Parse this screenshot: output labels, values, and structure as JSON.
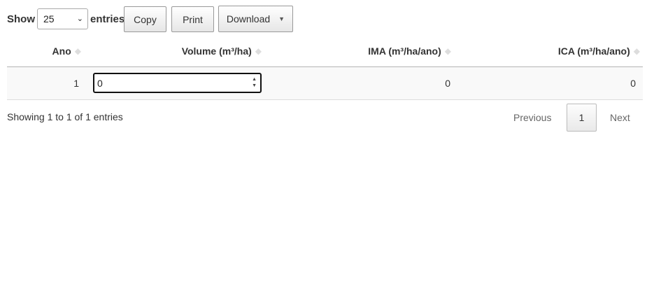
{
  "length_menu": {
    "prefix": "Show",
    "selected": "25",
    "suffix": "entries"
  },
  "buttons": {
    "copy": "Copy",
    "print": "Print",
    "download": "Download"
  },
  "table": {
    "columns": [
      {
        "label": "Ano"
      },
      {
        "label": "Volume (m³/ha)"
      },
      {
        "label": "IMA (m³/ha/ano)"
      },
      {
        "label": "ICA (m³/ha/ano)"
      }
    ],
    "rows": [
      {
        "ano": "1",
        "volume": "0",
        "ima": "0",
        "ica": "0"
      }
    ]
  },
  "info_text": "Showing 1 to 1 of 1 entries",
  "pagination": {
    "previous": "Previous",
    "current_page": "1",
    "next": "Next"
  },
  "icons": {
    "sort": "sort-both-icon",
    "dropdown": "caret-down-icon",
    "spinner": "spin-button-icon"
  }
}
